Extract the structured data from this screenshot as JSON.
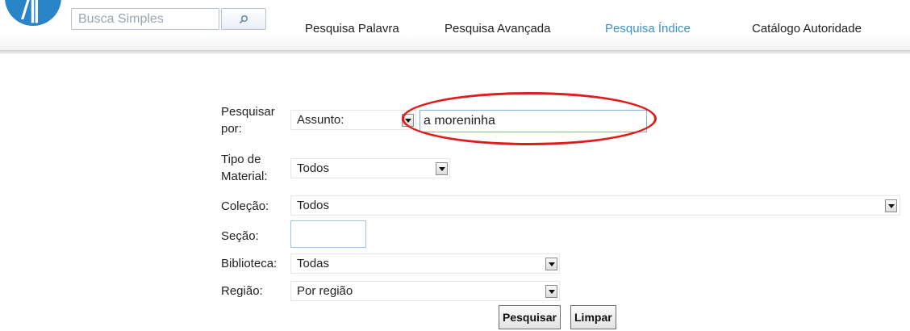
{
  "header": {
    "search": {
      "placeholder": "Busca Simples",
      "value": ""
    },
    "nav": [
      {
        "label": "Pesquisa Palavra",
        "active": false
      },
      {
        "label": "Pesquisa Avançada",
        "active": false
      },
      {
        "label": "Pesquisa Índice",
        "active": true
      },
      {
        "label": "Catálogo Autoridade",
        "active": false
      }
    ]
  },
  "form": {
    "search_by": {
      "label": "Pesquisar por:",
      "selected": "Assunto:",
      "value": "a moreninha"
    },
    "material_type": {
      "label": "Tipo de Material:",
      "selected": "Todos"
    },
    "collection": {
      "label": "Coleção:",
      "selected": "Todos"
    },
    "section": {
      "label": "Seção:",
      "value": ""
    },
    "library": {
      "label": "Biblioteca:",
      "selected": "Todas"
    },
    "region": {
      "label": "Região:",
      "selected": "Por região"
    },
    "buttons": {
      "search": "Pesquisar",
      "clear": "Limpar"
    }
  },
  "colors": {
    "accent": "#2a84c8",
    "active_nav": "#3c8fd3",
    "highlight": "#e11b1b"
  }
}
